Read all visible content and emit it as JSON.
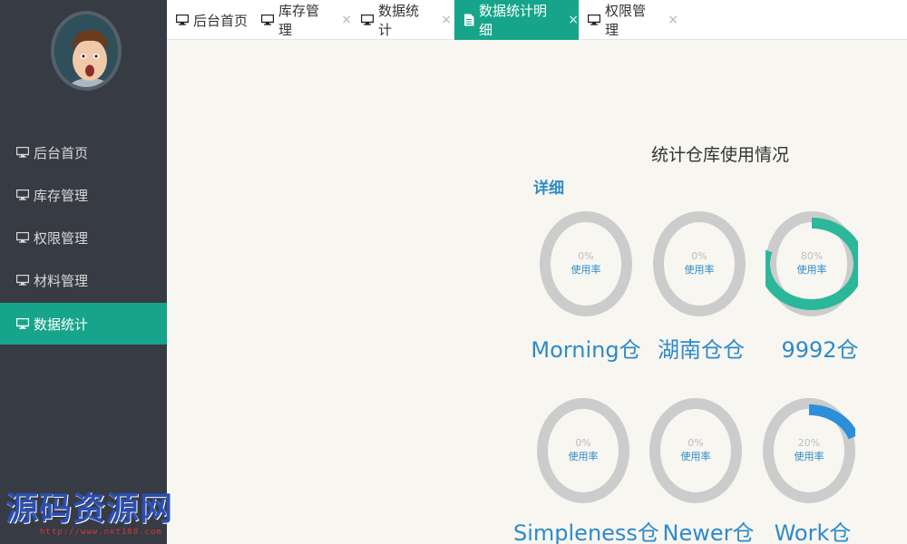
{
  "sidebar": {
    "items": [
      {
        "label": "后台首页"
      },
      {
        "label": "库存管理"
      },
      {
        "label": "权限管理"
      },
      {
        "label": "材料管理"
      },
      {
        "label": "数据统计"
      }
    ]
  },
  "tabs": [
    {
      "label": "后台首页"
    },
    {
      "label": "库存管理",
      "close": "×"
    },
    {
      "label": "数据统计",
      "close": "×"
    },
    {
      "label": "数据统计明细",
      "close": "×"
    },
    {
      "label": "权限管理",
      "close": "×"
    }
  ],
  "main": {
    "title": "统计仓库使用情况",
    "detail_label": "详细",
    "warehouses": [
      {
        "name": "Morning仓",
        "percent_text": "0%",
        "usage_label": "使用率",
        "value": 0,
        "color": "#cccccc"
      },
      {
        "name": "湖南仓仓",
        "percent_text": "0%",
        "usage_label": "使用率",
        "value": 0,
        "color": "#cccccc"
      },
      {
        "name": "9992仓",
        "percent_text": "80%",
        "usage_label": "使用率",
        "value": 80,
        "color": "#2bb79a"
      },
      {
        "name": "Simpleness仓",
        "percent_text": "0%",
        "usage_label": "使用率",
        "value": 0,
        "color": "#cccccc"
      },
      {
        "name": "Newer仓",
        "percent_text": "0%",
        "usage_label": "使用率",
        "value": 0,
        "color": "#cccccc"
      },
      {
        "name": "Work仓",
        "percent_text": "20%",
        "usage_label": "使用率",
        "value": 20,
        "color": "#2d8fd9"
      }
    ]
  },
  "watermark": {
    "text": "源码资源网",
    "url": "http://www.net188.com"
  },
  "colors": {
    "sidebar_bg": "#373b44",
    "accent": "#16a58a",
    "link_blue": "#2e8bc8",
    "ring_track": "#cccccc"
  }
}
